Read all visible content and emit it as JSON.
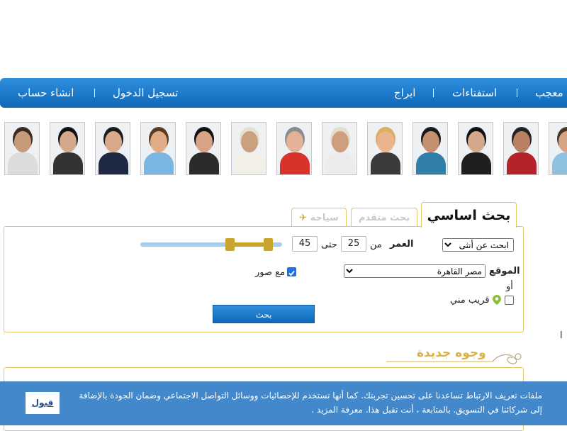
{
  "nav": {
    "items": [
      "معجب",
      "استفتاءات",
      "ابراج",
      "تسجيل الدخول",
      "انشاء حساب"
    ]
  },
  "avatars": [
    {
      "name": "avatar-1",
      "skin": "#c79a7a",
      "hair": "#3a2a20",
      "shirt": "#dcdcdc"
    },
    {
      "name": "avatar-2",
      "skin": "#d4a88a",
      "hair": "#111111",
      "shirt": "#333333"
    },
    {
      "name": "avatar-3",
      "skin": "#d9a98b",
      "hair": "#1a1a1a",
      "shirt": "#1e2a44"
    },
    {
      "name": "avatar-4",
      "skin": "#e0ac85",
      "hair": "#5a3a22",
      "shirt": "#7bb6e2"
    },
    {
      "name": "avatar-5",
      "skin": "#d7a487",
      "hair": "#111111",
      "shirt": "#2b2b2b"
    },
    {
      "name": "avatar-6",
      "skin": "#caa07f",
      "hair": "#e7e0d1",
      "shirt": "#f2efe6"
    },
    {
      "name": "avatar-7",
      "skin": "#e2b196",
      "hair": "#8b8b8b",
      "shirt": "#d8322c"
    },
    {
      "name": "avatar-8",
      "skin": "#cf9f7d",
      "hair": "#e6dccb",
      "shirt": "#ececec"
    },
    {
      "name": "avatar-9",
      "skin": "#eab48e",
      "hair": "#d8b060",
      "shirt": "#3a3a3a"
    },
    {
      "name": "avatar-10",
      "skin": "#c3916f",
      "hair": "#1a1a1a",
      "shirt": "#2f7fa8"
    },
    {
      "name": "avatar-11",
      "skin": "#d4a88a",
      "hair": "#111111",
      "shirt": "#1f1f1f"
    },
    {
      "name": "avatar-12",
      "skin": "#b98064",
      "hair": "#222222",
      "shirt": "#b4232a"
    },
    {
      "name": "avatar-13",
      "skin": "#d6a483",
      "hair": "#4a3524",
      "shirt": "#8fc0e0"
    }
  ],
  "tabs": {
    "basic": "بحث اساسي",
    "advanced": "بحث متقدم",
    "travel": "سياحة"
  },
  "search": {
    "gender_selected": "ابحث عن أنثى",
    "age_label": "العمر",
    "from_label": "من",
    "age_from": "25",
    "to_label": "حتى",
    "age_to": "45",
    "location_label": "الموقع",
    "location_selected": "مصر القاهرة",
    "photos_label": "مع صور",
    "photos_checked": true,
    "or_label": "أو",
    "near_me_label": "قريب مني",
    "near_me_checked": false,
    "submit_label": "بحث",
    "age_slider": {
      "min": 18,
      "max": 99,
      "low": 25,
      "high": 45
    }
  },
  "new_faces": {
    "title": "وجوه جديدة"
  },
  "side_fragment": "ا",
  "cookie": {
    "text": "ملفات تعريف الارتباط تساعدنا على تحسين تجربتك. كما أنها تستخدم للإحصائيات ووسائل التواصل الاجتماعي وضمان الجودة بالإضافة إلى شركائنا في التسويق. بالمتابعة ، أنت تقبل هذا. معرفة المزيد .",
    "accept_label": "قبول"
  },
  "colors": {
    "nav_blue": "#1f7bcd",
    "gold": "#c9a62b",
    "slider_blue": "#a9cdee",
    "banner_blue": "#347ec8"
  }
}
